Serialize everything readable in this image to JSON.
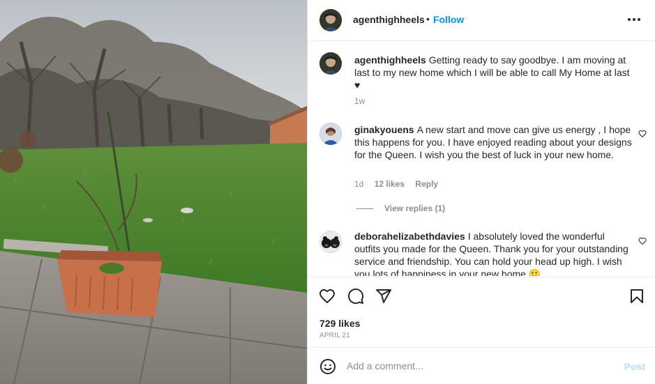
{
  "header": {
    "username": "agenthighheels",
    "separator": "•",
    "follow_label": "Follow",
    "more_icon": "more-horizontal-icon"
  },
  "caption": {
    "username": "agenthighheels",
    "text": "Getting ready to say goodbye. I am moving at last to my new home which I will be able to call My Home at last ♥",
    "time": "1w"
  },
  "comments": [
    {
      "username": "ginakyouens",
      "text": "A new start and move can give us energy , I hope this happens for you. I have enjoyed reading about your designs for the Queen. I wish you the best of luck in your new home.",
      "time": "1d",
      "likes": "12 likes",
      "reply_label": "Reply",
      "view_replies": "View replies (1)"
    },
    {
      "username": "deborahelizabethdavies",
      "text": "I absolutely loved the wonderful outfits you made for the Queen. Thank you for your outstanding service and friendship. You can hold your head up high. I wish you lots of happiness in your new home 🙂"
    }
  ],
  "actions": {
    "icons": [
      "heart-icon",
      "comment-icon",
      "share-icon",
      "bookmark-icon"
    ]
  },
  "likes_count": "729 likes",
  "post_date": "APRIL 21",
  "add_comment": {
    "placeholder": "Add a comment...",
    "post_label": "Post"
  },
  "colors": {
    "accent": "#0095f6",
    "post_disabled": "#b2dffc",
    "muted": "#8e8e8e"
  }
}
